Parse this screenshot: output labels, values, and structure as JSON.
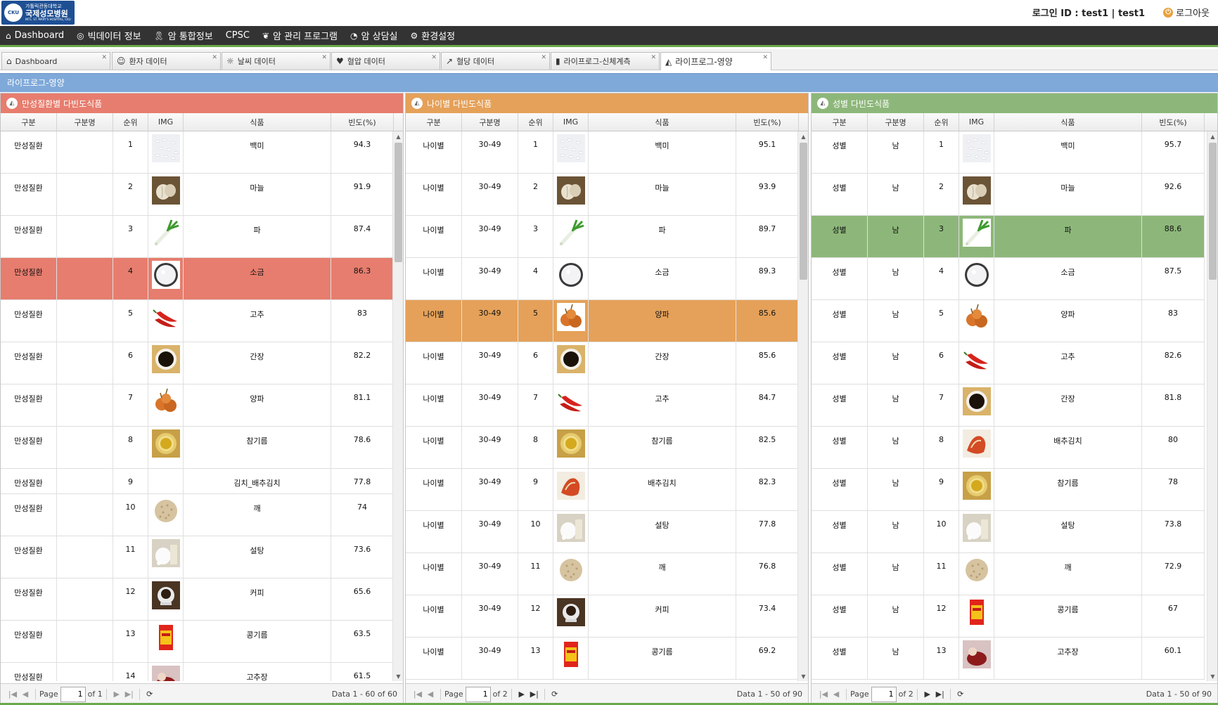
{
  "header": {
    "logo": {
      "line1": "가톨릭관동대학교",
      "line2": "국제성모병원",
      "line3": "INTL. ST. MARY'S HOSPITAL, CKU",
      "seal": "CKU"
    },
    "login_info": "로그인 ID : test1 | test1",
    "logout_label": "로그아웃"
  },
  "menu": [
    {
      "label": "Dashboard",
      "icon": "home-icon",
      "glyph": "⌂"
    },
    {
      "label": "빅데이터 정보",
      "icon": "target-icon",
      "glyph": "◎"
    },
    {
      "label": "암 통합정보",
      "icon": "ribbon-icon",
      "glyph": "🎗"
    },
    {
      "label": "CPSC",
      "icon": "",
      "glyph": ""
    },
    {
      "label": "암 관리 프로그램",
      "icon": "plant-icon",
      "glyph": "❦"
    },
    {
      "label": "암 상담실",
      "icon": "person-icon",
      "glyph": "◔"
    },
    {
      "label": "환경설정",
      "icon": "gear-icon",
      "glyph": "⚙"
    }
  ],
  "tabs": [
    {
      "label": "Dashboard",
      "icon": "home-icon",
      "glyph": "⌂",
      "active": false
    },
    {
      "label": "환자 데이터",
      "icon": "person-icon",
      "glyph": "☺",
      "active": false
    },
    {
      "label": "날씨 데이터",
      "icon": "sun-icon",
      "glyph": "☼",
      "active": false
    },
    {
      "label": "혈압 데이터",
      "icon": "heart-icon",
      "glyph": "♥",
      "active": false
    },
    {
      "label": "혈당 데이터",
      "icon": "chart-icon",
      "glyph": "↗",
      "active": false
    },
    {
      "label": "라이프로그-신체계측",
      "icon": "ruler-icon",
      "glyph": "▮",
      "active": false
    },
    {
      "label": "라이프로그-영양",
      "icon": "megaphone-icon",
      "glyph": "◭",
      "active": true
    }
  ],
  "page_title": "라이프로그-영양",
  "columns": [
    "구분",
    "구분명",
    "순위",
    "IMG",
    "식품",
    "빈도(%)"
  ],
  "pager_labels": {
    "page": "Page"
  },
  "panels": [
    {
      "title": "만성질환별 다빈도식품",
      "head_color": "#e77d6e",
      "selected_index": 3,
      "selected_class": "sel-red",
      "page": "1",
      "of": "of 1",
      "summary": "Data 1 - 60 of 60",
      "rows": [
        {
          "cat": "만성질환",
          "name": "",
          "rank": "1",
          "food": "백미",
          "img": "rice",
          "freq": "94.3"
        },
        {
          "cat": "만성질환",
          "name": "",
          "rank": "2",
          "food": "마늘",
          "img": "garlic",
          "freq": "91.9"
        },
        {
          "cat": "만성질환",
          "name": "",
          "rank": "3",
          "food": "파",
          "img": "scallion",
          "freq": "87.4"
        },
        {
          "cat": "만성질환",
          "name": "",
          "rank": "4",
          "food": "소금",
          "img": "salt",
          "freq": "86.3"
        },
        {
          "cat": "만성질환",
          "name": "",
          "rank": "5",
          "food": "고추",
          "img": "pepper",
          "freq": "83"
        },
        {
          "cat": "만성질환",
          "name": "",
          "rank": "6",
          "food": "간장",
          "img": "soysauce",
          "freq": "82.2"
        },
        {
          "cat": "만성질환",
          "name": "",
          "rank": "7",
          "food": "양파",
          "img": "onion",
          "freq": "81.1"
        },
        {
          "cat": "만성질환",
          "name": "",
          "rank": "8",
          "food": "참기름",
          "img": "sesameoil",
          "freq": "78.6"
        },
        {
          "cat": "만성질환",
          "name": "",
          "rank": "9",
          "food": "김치_배추김치",
          "img": "none",
          "freq": "77.8"
        },
        {
          "cat": "만성질환",
          "name": "",
          "rank": "10",
          "food": "깨",
          "img": "sesame",
          "freq": "74"
        },
        {
          "cat": "만성질환",
          "name": "",
          "rank": "11",
          "food": "설탕",
          "img": "sugar",
          "freq": "73.6"
        },
        {
          "cat": "만성질환",
          "name": "",
          "rank": "12",
          "food": "커피",
          "img": "coffee",
          "freq": "65.6"
        },
        {
          "cat": "만성질환",
          "name": "",
          "rank": "13",
          "food": "콩기름",
          "img": "soyoil",
          "freq": "63.5"
        },
        {
          "cat": "만성질환",
          "name": "",
          "rank": "14",
          "food": "고추장",
          "img": "gochujang",
          "freq": "61.5"
        }
      ]
    },
    {
      "title": "나이별 다빈도식품",
      "head_color": "#e5a159",
      "selected_index": 4,
      "selected_class": "sel-orange",
      "page": "1",
      "of": "of 2",
      "summary": "Data 1 - 50 of 90",
      "rows": [
        {
          "cat": "나이별",
          "name": "30-49",
          "rank": "1",
          "food": "백미",
          "img": "rice",
          "freq": "95.1"
        },
        {
          "cat": "나이별",
          "name": "30-49",
          "rank": "2",
          "food": "마늘",
          "img": "garlic",
          "freq": "93.9"
        },
        {
          "cat": "나이별",
          "name": "30-49",
          "rank": "3",
          "food": "파",
          "img": "scallion",
          "freq": "89.7"
        },
        {
          "cat": "나이별",
          "name": "30-49",
          "rank": "4",
          "food": "소금",
          "img": "salt",
          "freq": "89.3"
        },
        {
          "cat": "나이별",
          "name": "30-49",
          "rank": "5",
          "food": "양파",
          "img": "onion",
          "freq": "85.6"
        },
        {
          "cat": "나이별",
          "name": "30-49",
          "rank": "6",
          "food": "간장",
          "img": "soysauce",
          "freq": "85.6"
        },
        {
          "cat": "나이별",
          "name": "30-49",
          "rank": "7",
          "food": "고추",
          "img": "pepper",
          "freq": "84.7"
        },
        {
          "cat": "나이별",
          "name": "30-49",
          "rank": "8",
          "food": "참기름",
          "img": "sesameoil",
          "freq": "82.5"
        },
        {
          "cat": "나이별",
          "name": "30-49",
          "rank": "9",
          "food": "배추김치",
          "img": "kimchi",
          "freq": "82.3"
        },
        {
          "cat": "나이별",
          "name": "30-49",
          "rank": "10",
          "food": "설탕",
          "img": "sugar",
          "freq": "77.8"
        },
        {
          "cat": "나이별",
          "name": "30-49",
          "rank": "11",
          "food": "깨",
          "img": "sesame",
          "freq": "76.8"
        },
        {
          "cat": "나이별",
          "name": "30-49",
          "rank": "12",
          "food": "커피",
          "img": "coffee",
          "freq": "73.4"
        },
        {
          "cat": "나이별",
          "name": "30-49",
          "rank": "13",
          "food": "콩기름",
          "img": "soyoil",
          "freq": "69.2"
        }
      ]
    },
    {
      "title": "성별 다빈도식품",
      "head_color": "#8db77a",
      "selected_index": 2,
      "selected_class": "sel-green",
      "page": "1",
      "of": "of 2",
      "summary": "Data 1 - 50 of 90",
      "rows": [
        {
          "cat": "성별",
          "name": "남",
          "rank": "1",
          "food": "백미",
          "img": "rice",
          "freq": "95.7"
        },
        {
          "cat": "성별",
          "name": "남",
          "rank": "2",
          "food": "마늘",
          "img": "garlic",
          "freq": "92.6"
        },
        {
          "cat": "성별",
          "name": "남",
          "rank": "3",
          "food": "파",
          "img": "scallion",
          "freq": "88.6"
        },
        {
          "cat": "성별",
          "name": "남",
          "rank": "4",
          "food": "소금",
          "img": "salt",
          "freq": "87.5"
        },
        {
          "cat": "성별",
          "name": "남",
          "rank": "5",
          "food": "양파",
          "img": "onion",
          "freq": "83"
        },
        {
          "cat": "성별",
          "name": "남",
          "rank": "6",
          "food": "고추",
          "img": "pepper",
          "freq": "82.6"
        },
        {
          "cat": "성별",
          "name": "남",
          "rank": "7",
          "food": "간장",
          "img": "soysauce",
          "freq": "81.8"
        },
        {
          "cat": "성별",
          "name": "남",
          "rank": "8",
          "food": "배추김치",
          "img": "kimchi",
          "freq": "80"
        },
        {
          "cat": "성별",
          "name": "남",
          "rank": "9",
          "food": "참기름",
          "img": "sesameoil",
          "freq": "78"
        },
        {
          "cat": "성별",
          "name": "남",
          "rank": "10",
          "food": "설탕",
          "img": "sugar",
          "freq": "73.8"
        },
        {
          "cat": "성별",
          "name": "남",
          "rank": "11",
          "food": "깨",
          "img": "sesame",
          "freq": "72.9"
        },
        {
          "cat": "성별",
          "name": "남",
          "rank": "12",
          "food": "콩기름",
          "img": "soyoil",
          "freq": "67"
        },
        {
          "cat": "성별",
          "name": "남",
          "rank": "13",
          "food": "고추장",
          "img": "gochujang",
          "freq": "60.1"
        }
      ]
    }
  ]
}
